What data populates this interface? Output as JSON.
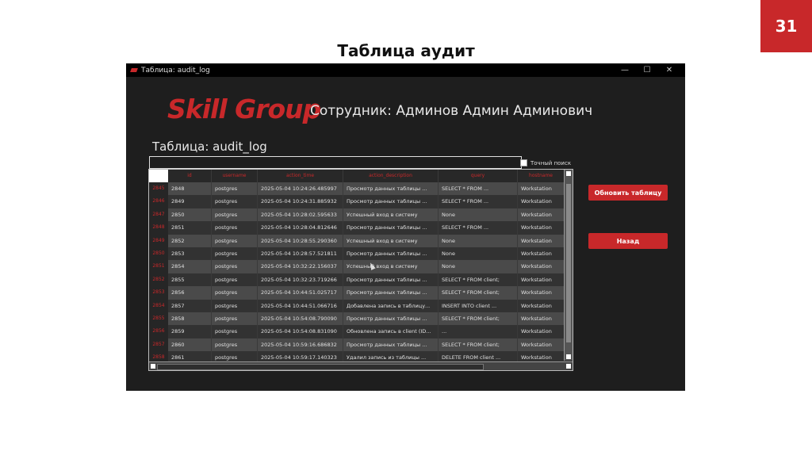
{
  "slide": {
    "number": "31",
    "title": "Таблица аудит"
  },
  "window": {
    "title": "Таблица: audit_log",
    "controls": [
      "—",
      "☐",
      "✕"
    ]
  },
  "app": {
    "logo": "Skill Group",
    "employee": "Сотрудник: Админов Админ Админович",
    "table_title": "Таблица: audit_log",
    "search": {
      "value": "",
      "placeholder": ""
    },
    "exact_search_label": "Точный поиск",
    "refresh_button": "Обновить таблицу",
    "back_button": "Назад"
  },
  "grid": {
    "columns": [
      "id",
      "username",
      "action_time",
      "action_description",
      "query",
      "hostname"
    ],
    "rows": [
      [
        "2845",
        "2848",
        "postgres",
        "2025-05-04 10:24:26.485997",
        "Просмотр данных таблицы ...",
        "SELECT * FROM ...",
        "Workstation"
      ],
      [
        "2846",
        "2849",
        "postgres",
        "2025-05-04 10:24:31.885932",
        "Просмотр данных таблицы ...",
        "SELECT * FROM ...",
        "Workstation"
      ],
      [
        "2847",
        "2850",
        "postgres",
        "2025-05-04 10:28:02.595633",
        "Успешный вход в систему",
        "None",
        "Workstation"
      ],
      [
        "2848",
        "2851",
        "postgres",
        "2025-05-04 10:28:04.812646",
        "Просмотр данных таблицы ...",
        "SELECT * FROM ...",
        "Workstation"
      ],
      [
        "2849",
        "2852",
        "postgres",
        "2025-05-04 10:28:55.290360",
        "Успешный вход в систему",
        "None",
        "Workstation"
      ],
      [
        "2850",
        "2853",
        "postgres",
        "2025-05-04 10:28:57.521811",
        "Просмотр данных таблицы ...",
        "None",
        "Workstation"
      ],
      [
        "2851",
        "2854",
        "postgres",
        "2025-05-04 10:32:22.156037",
        "Успешный вход в систему",
        "None",
        "Workstation"
      ],
      [
        "2852",
        "2855",
        "postgres",
        "2025-05-04 10:32:23.719266",
        "Просмотр данных таблицы ...",
        "SELECT * FROM client;",
        "Workstation"
      ],
      [
        "2853",
        "2856",
        "postgres",
        "2025-05-04 10:44:51.025717",
        "Просмотр данных таблицы ...",
        "SELECT * FROM client;",
        "Workstation"
      ],
      [
        "2854",
        "2857",
        "postgres",
        "2025-05-04 10:44:51.066716",
        "Добавлена запись в таблицу...",
        "INSERT INTO client ...",
        "Workstation"
      ],
      [
        "2855",
        "2858",
        "postgres",
        "2025-05-04 10:54:08.790090",
        "Просмотр данных таблицы ...",
        "SELECT * FROM client;",
        "Workstation"
      ],
      [
        "2856",
        "2859",
        "postgres",
        "2025-05-04 10:54:08.831090",
        "Обновлена запись в client (ID...",
        "...",
        "Workstation"
      ],
      [
        "2857",
        "2860",
        "postgres",
        "2025-05-04 10:59:16.686832",
        "Просмотр данных таблицы ...",
        "SELECT * FROM client;",
        "Workstation"
      ],
      [
        "2858",
        "2861",
        "postgres",
        "2025-05-04 10:59:17.140323",
        "Удалил запись из таблицы ...",
        "DELETE FROM client ...",
        "Workstation"
      ]
    ]
  }
}
